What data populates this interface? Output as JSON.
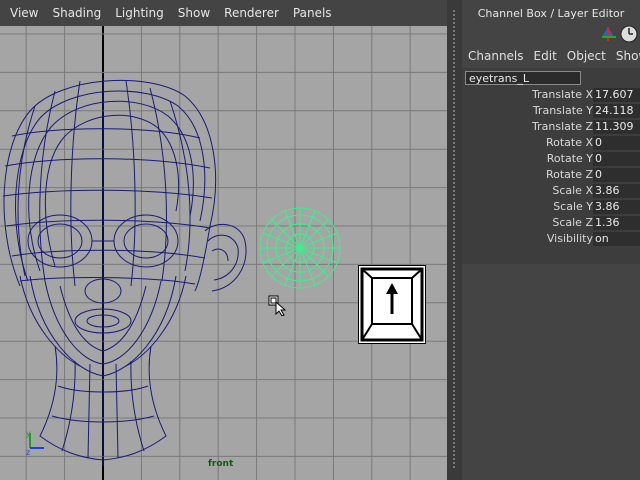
{
  "viewport": {
    "menus": [
      "View",
      "Shading",
      "Lighting",
      "Show",
      "Renderer",
      "Panels"
    ],
    "camera_label": "front",
    "axis_labels": {
      "y": "y",
      "z": "z"
    },
    "colors": {
      "background": "#a5a5a5",
      "grid_line": "#7a7a7a",
      "grid_axis": "#000000",
      "head_wireframe": "#1a1a78",
      "eye_wireframe": "#3cf08c",
      "camera_label": "#0b5d0b"
    },
    "key_hint_icon": "up-arrow-key-icon",
    "cursor_icon": "arrow-pointer-icon"
  },
  "channel_box": {
    "title": "Channel Box / Layer Editor",
    "menus": [
      "Channels",
      "Edit",
      "Object",
      "Show"
    ],
    "object_name": "eyetrans_L",
    "attributes": [
      {
        "label": "Translate X",
        "value": "17.607"
      },
      {
        "label": "Translate Y",
        "value": "24.118"
      },
      {
        "label": "Translate Z",
        "value": "11.309"
      },
      {
        "label": "Rotate X",
        "value": "0"
      },
      {
        "label": "Rotate Y",
        "value": "0"
      },
      {
        "label": "Rotate Z",
        "value": "0"
      },
      {
        "label": "Scale X",
        "value": "3.86"
      },
      {
        "label": "Scale Y",
        "value": "3.86"
      },
      {
        "label": "Scale Z",
        "value": "1.36"
      },
      {
        "label": "Visibility",
        "value": "on"
      }
    ],
    "toolbar_icons": [
      "layers-icon",
      "clock-icon"
    ]
  }
}
